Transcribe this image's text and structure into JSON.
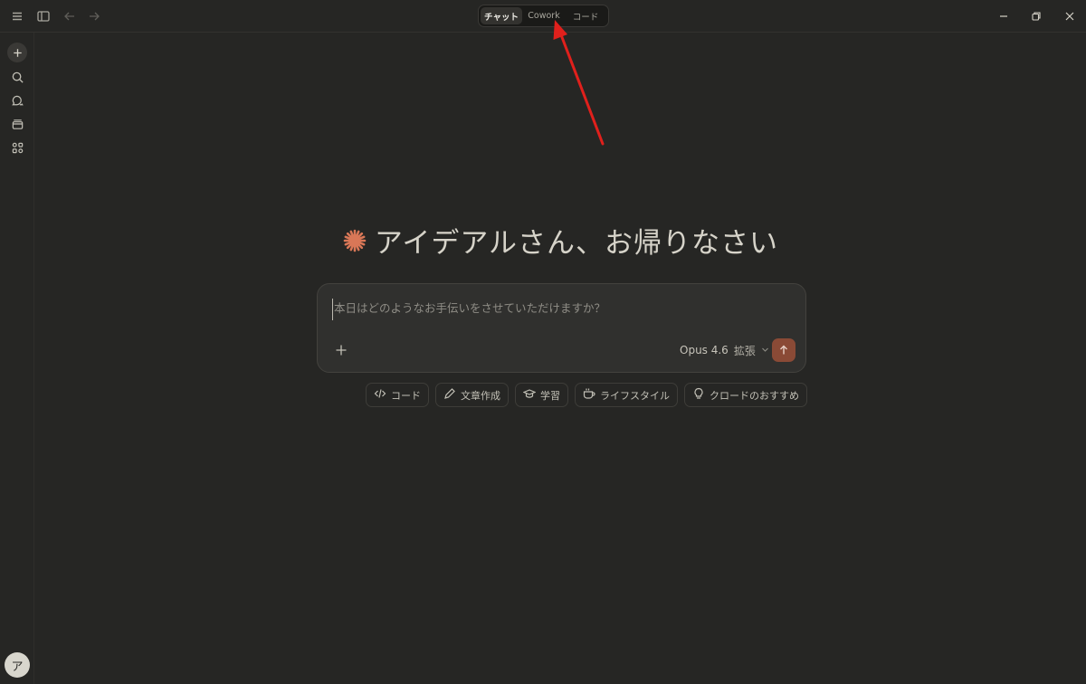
{
  "titlebar": {
    "mode_tabs": [
      {
        "label": "チャット",
        "active": true
      },
      {
        "label": "Cowork",
        "active": false
      },
      {
        "label": "コード",
        "active": false
      }
    ],
    "icons": {
      "menu": "hamburger-menu-icon",
      "sidebar_toggle": "sidebar-toggle-icon",
      "back": "arrow-left-icon",
      "forward": "arrow-right-icon",
      "minimize": "minimize-icon",
      "restore": "restore-icon",
      "close": "close-icon"
    }
  },
  "sidebar": {
    "items": [
      "new-chat-icon",
      "search-icon",
      "chats-icon",
      "projects-icon",
      "artifacts-icon"
    ],
    "avatar_initial": "ア"
  },
  "main": {
    "greeting": "アイデアルさん、お帰りなさい",
    "composer": {
      "placeholder": "本日はどのようなお手伝いをさせていただけますか？",
      "model_name": "Opus 4.6",
      "model_mode": "拡張"
    },
    "chips": [
      {
        "icon": "code-icon",
        "label": "コード"
      },
      {
        "icon": "pencil-icon",
        "label": "文章作成"
      },
      {
        "icon": "graduation-cap-icon",
        "label": "学習"
      },
      {
        "icon": "coffee-cup-icon",
        "label": "ライフスタイル"
      },
      {
        "icon": "lightbulb-icon",
        "label": "クロードのおすすめ"
      }
    ]
  },
  "colors": {
    "background": "#262624",
    "accent": "#d97757",
    "send_button": "#8a4a36",
    "annotation_arrow": "#e0201c"
  }
}
